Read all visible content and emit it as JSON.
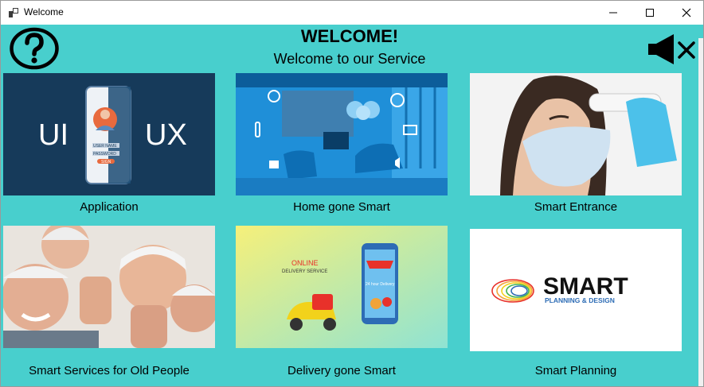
{
  "window": {
    "title": "Welcome",
    "icons": {
      "app": "app-icon",
      "minimize": "minimize-icon",
      "maximize": "maximize-icon",
      "close": "close-icon"
    }
  },
  "header": {
    "title": "WELCOME!",
    "subtitle": "Welcome to our Service",
    "help_icon": "question-circle-icon",
    "mute_icon": "speaker-muted-icon"
  },
  "tiles": [
    {
      "label": "Application",
      "image_text": [
        "UI",
        "UX"
      ],
      "ui_text": [
        "USER NAME",
        "PASSWORD",
        "SIGN"
      ]
    },
    {
      "label": "Home gone Smart"
    },
    {
      "label": "Smart Entrance"
    },
    {
      "label": "Smart Services for Old People"
    },
    {
      "label": "Delivery gone Smart",
      "image_text": [
        "ONLINE",
        "DELIVERY SERVICE",
        "24 hour Delivery"
      ]
    },
    {
      "label": "Smart Planning",
      "image_text": [
        "SMART",
        "PLANNING & DESIGN"
      ]
    }
  ],
  "colors": {
    "background": "#48cfcd",
    "tile_dark": "#163a5a",
    "smart_home_blue": "#1f8fd8",
    "delivery_red": "#e8312a"
  }
}
